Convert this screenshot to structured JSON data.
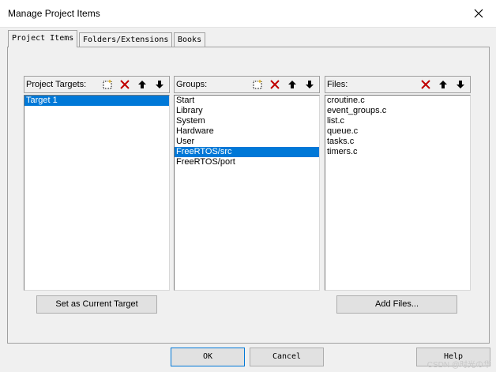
{
  "window": {
    "title": "Manage Project Items"
  },
  "tabs": [
    {
      "label": "Project Items",
      "active": true
    },
    {
      "label": "Folders/Extensions",
      "active": false
    },
    {
      "label": "Books",
      "active": false
    }
  ],
  "targets": {
    "label": "Project Targets:",
    "items": [
      "Target 1"
    ],
    "selected": 0,
    "set_current_label": "Set as Current Target"
  },
  "groups": {
    "label": "Groups:",
    "items": [
      "Start",
      "Library",
      "System",
      "Hardware",
      "User",
      "FreeRTOS/src",
      "FreeRTOS/port"
    ],
    "selected": 5
  },
  "files": {
    "label": "Files:",
    "items": [
      "croutine.c",
      "event_groups.c",
      "list.c",
      "queue.c",
      "tasks.c",
      "timers.c"
    ],
    "add_files_label": "Add Files..."
  },
  "footer": {
    "ok_label": "OK",
    "cancel_label": "Cancel",
    "help_label": "Help"
  },
  "watermark": "CSDN @时光の华",
  "colors": {
    "selection": "#0078d7",
    "delete": "#c00000"
  }
}
